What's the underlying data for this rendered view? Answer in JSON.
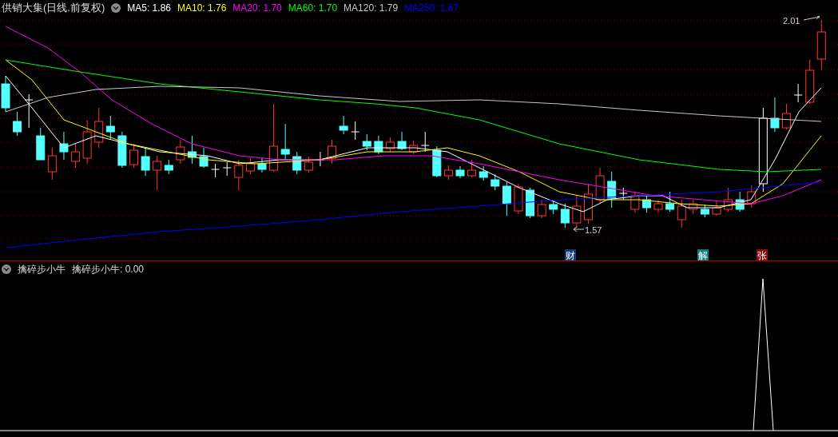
{
  "main_pane": {
    "title": "供销大集(日线.前复权)",
    "moving_averages": [
      {
        "label": "MA5: 1.86",
        "color": "#ffffff"
      },
      {
        "label": "MA10: 1.76",
        "color": "#ffff00"
      },
      {
        "label": "MA20: 1.70",
        "color": "#ff00ff"
      },
      {
        "label": "MA60: 1.70",
        "color": "#00ff00"
      },
      {
        "label": "MA120: 1.79",
        "color": "#c8c8c8"
      },
      {
        "label": "MA250: 1.67",
        "color": "#0000ff"
      }
    ],
    "high_marker": "2.01",
    "low_marker": "1.57",
    "event_badges": [
      {
        "text": "财",
        "color": "#103a78"
      },
      {
        "text": "解",
        "color": "#0e7c7c"
      },
      {
        "text": "张",
        "color": "#8a0e0e"
      }
    ]
  },
  "indicator_pane": {
    "name": "擒碎步小牛",
    "readout": "擒碎步小牛: 0.00"
  }
}
